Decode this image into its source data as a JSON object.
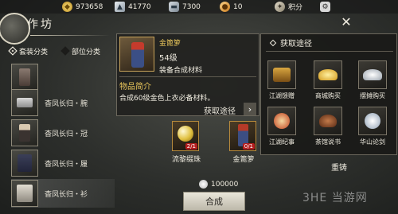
{
  "topbar": {
    "currencies": [
      {
        "icon": "gold-ingot-icon",
        "value": "973658"
      },
      {
        "icon": "silver-ingot-icon",
        "value": "41770"
      },
      {
        "icon": "silver-bar-icon",
        "value": "7300"
      },
      {
        "icon": "coupon-icon",
        "value": "10"
      },
      {
        "icon": "points-icon",
        "value": "积分"
      }
    ]
  },
  "header": {
    "title": "作坊"
  },
  "filters": {
    "set": "套装分类",
    "part": "部位分类"
  },
  "list": {
    "items": [
      {
        "label": "杳凤长归・腕"
      },
      {
        "label": "杳凤长归・冠"
      },
      {
        "label": "杳凤长归・履"
      },
      {
        "label": "杳凤长归・衫"
      }
    ]
  },
  "item_card": {
    "name": "金篦箩",
    "level": "54级",
    "type": "装备合成材料",
    "intro_title": "物品简介",
    "description": "合成60级金色上衣必备材料。",
    "source_link": "获取途径",
    "arrow": "›"
  },
  "materials": [
    {
      "label": "流黎缀珠",
      "count": "2/1"
    },
    {
      "label": "金篦箩",
      "count": "0/1"
    }
  ],
  "sources": {
    "title": "获取途径",
    "items": [
      {
        "label": "江湖馈赠"
      },
      {
        "label": "商城购买"
      },
      {
        "label": "摆摊购买"
      },
      {
        "label": "江湖纪事"
      },
      {
        "label": "茶馆说书"
      },
      {
        "label": "华山论剑"
      }
    ]
  },
  "recast": "重铸",
  "cost": "100000",
  "craft": "合成",
  "close": "✕",
  "watermark": "3HE 当游网",
  "colors": {
    "gold_text": "#e7c45a",
    "warning_badge": "#b41e1e"
  }
}
